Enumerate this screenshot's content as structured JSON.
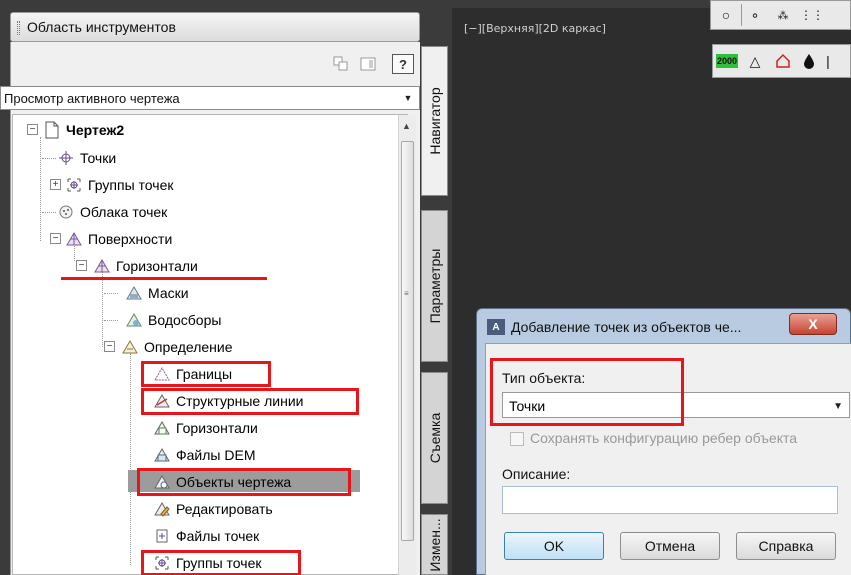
{
  "toolspace": {
    "title": "Область инструментов",
    "toolbar": {
      "help_label": "?"
    },
    "view_select": {
      "value": "Просмотр активного чертежа"
    },
    "tree": {
      "root": "Чертеж2",
      "points": "Точки",
      "point_groups": "Группы точек",
      "point_clouds": "Облака точек",
      "surfaces": "Поверхности",
      "surface_contours": "Горизонтали",
      "masks": "Маски",
      "watersheds": "Водосборы",
      "definition": "Определение",
      "boundaries": "Границы",
      "breaklines": "Структурные линии",
      "contours": "Горизонтали",
      "dem_files": "Файлы DEM",
      "drawing_objects": "Объекты чертежа",
      "edits": "Редактировать",
      "point_files": "Файлы точек",
      "def_point_groups": "Группы точек"
    },
    "tabs": [
      "Навигатор",
      "Параметры",
      "Съемка",
      "Измен..."
    ]
  },
  "viewport": {
    "label": "[−][Верхняя][2D каркас]",
    "badge": "2000"
  },
  "dialog": {
    "title": "Добавление точек из объектов че...",
    "close_label": "X",
    "object_type_label": "Тип объекта:",
    "object_type_value": "Точки",
    "checkbox_label": "Сохранять конфигурацию ребер объекта",
    "description_label": "Описание:",
    "description_value": "",
    "buttons": {
      "ok": "OK",
      "cancel": "Отмена",
      "help": "Справка"
    }
  },
  "colors": {
    "highlight": "#e8151b",
    "panel": "#f0f0f0",
    "viewport": "#2d2d2d",
    "dialog_frame": "#b8cbe0"
  }
}
